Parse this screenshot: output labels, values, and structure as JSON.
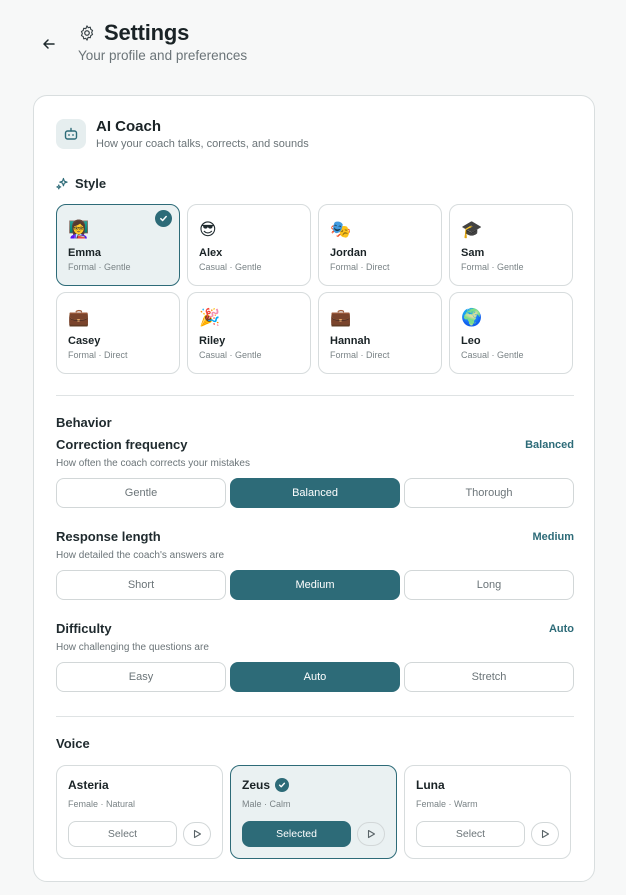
{
  "header": {
    "title": "Settings",
    "subtitle": "Your profile and preferences"
  },
  "coach_section": {
    "title": "AI Coach",
    "subtitle": "How your coach talks, corrects, and sounds",
    "style_label": "Style",
    "coaches": [
      {
        "emoji": "👩‍🏫",
        "name": "Emma",
        "desc": "Formal · Gentle",
        "selected": true
      },
      {
        "emoji": "😎",
        "name": "Alex",
        "desc": "Casual · Gentle",
        "selected": false
      },
      {
        "emoji": "🎭",
        "name": "Jordan",
        "desc": "Formal · Direct",
        "selected": false
      },
      {
        "emoji": "🎓",
        "name": "Sam",
        "desc": "Formal · Gentle",
        "selected": false
      },
      {
        "emoji": "💼",
        "name": "Casey",
        "desc": "Formal · Direct",
        "selected": false
      },
      {
        "emoji": "🎉",
        "name": "Riley",
        "desc": "Casual · Gentle",
        "selected": false
      },
      {
        "emoji": "💼",
        "name": "Hannah",
        "desc": "Formal · Direct",
        "selected": false
      },
      {
        "emoji": "🌍",
        "name": "Leo",
        "desc": "Casual · Gentle",
        "selected": false
      }
    ]
  },
  "behavior": {
    "title": "Behavior",
    "correction": {
      "label": "Correction frequency",
      "value": "Balanced",
      "help": "How often the coach corrects your mistakes",
      "options": [
        "Gentle",
        "Balanced",
        "Thorough"
      ]
    },
    "response": {
      "label": "Response length",
      "value": "Medium",
      "help": "How detailed the coach's answers are",
      "options": [
        "Short",
        "Medium",
        "Long"
      ]
    },
    "difficulty": {
      "label": "Difficulty",
      "value": "Auto",
      "help": "How challenging the questions are",
      "options": [
        "Easy",
        "Auto",
        "Stretch"
      ]
    }
  },
  "voice": {
    "title": "Voice",
    "voices": [
      {
        "name": "Asteria",
        "desc": "Female · Natural",
        "button": "Select",
        "selected": false
      },
      {
        "name": "Zeus",
        "desc": "Male · Calm",
        "button": "Selected",
        "selected": true
      },
      {
        "name": "Luna",
        "desc": "Female · Warm",
        "button": "Select",
        "selected": false
      }
    ]
  },
  "colors": {
    "accent": "#2d6b78",
    "selected_bg": "#eaf1f2",
    "background": "#f7f8f8"
  },
  "icons": {
    "back": "arrow-left-icon",
    "settings": "gear-icon",
    "coach": "robot-icon",
    "style": "sparkles-icon",
    "check": "check-icon",
    "play": "play-icon"
  }
}
